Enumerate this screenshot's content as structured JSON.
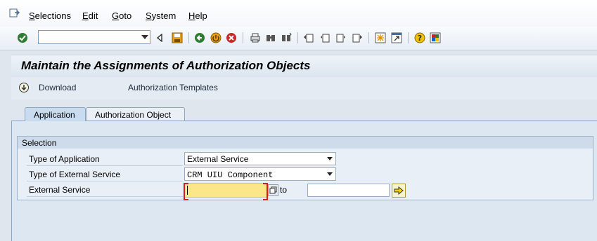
{
  "menu": {
    "items": [
      {
        "label": "Selections",
        "underline": "S",
        "rest": "elections"
      },
      {
        "label": "Edit",
        "underline": "E",
        "rest": "dit"
      },
      {
        "label": "Goto",
        "underline": "G",
        "rest": "oto"
      },
      {
        "label": "System",
        "underline": "S",
        "rest": "ystem"
      },
      {
        "label": "Help",
        "underline": "H",
        "rest": "elp"
      }
    ]
  },
  "toolbar": {
    "command_value": "",
    "icons": [
      "enter-icon",
      "back-arrow-icon",
      "save-icon",
      "back-icon",
      "exit-icon",
      "cancel-icon",
      "print-icon",
      "find-icon",
      "find-next-icon",
      "first-page-icon",
      "previous-page-icon",
      "next-page-icon",
      "last-page-icon",
      "create-session-icon",
      "shortcut-icon",
      "help-icon",
      "customize-layout-icon"
    ]
  },
  "title": "Maintain the Assignments of Authorization Objects",
  "app_toolbar": {
    "download_label": "Download",
    "templates_label": "Authorization Templates"
  },
  "tabs": [
    {
      "label": "Application",
      "active": true
    },
    {
      "label": "Authorization Object",
      "active": false
    }
  ],
  "selection": {
    "title": "Selection",
    "type_of_application": {
      "label": "Type of Application",
      "value": "External Service"
    },
    "type_of_external_service": {
      "label": "Type of External Service",
      "value": "CRM UIU Component"
    },
    "external_service": {
      "label": "External Service",
      "value": "",
      "to_label": "to",
      "to_value": ""
    }
  },
  "colors": {
    "background": "#dfe6ee",
    "required_field": "#fce68a",
    "active_tab": "#c9dcef"
  }
}
